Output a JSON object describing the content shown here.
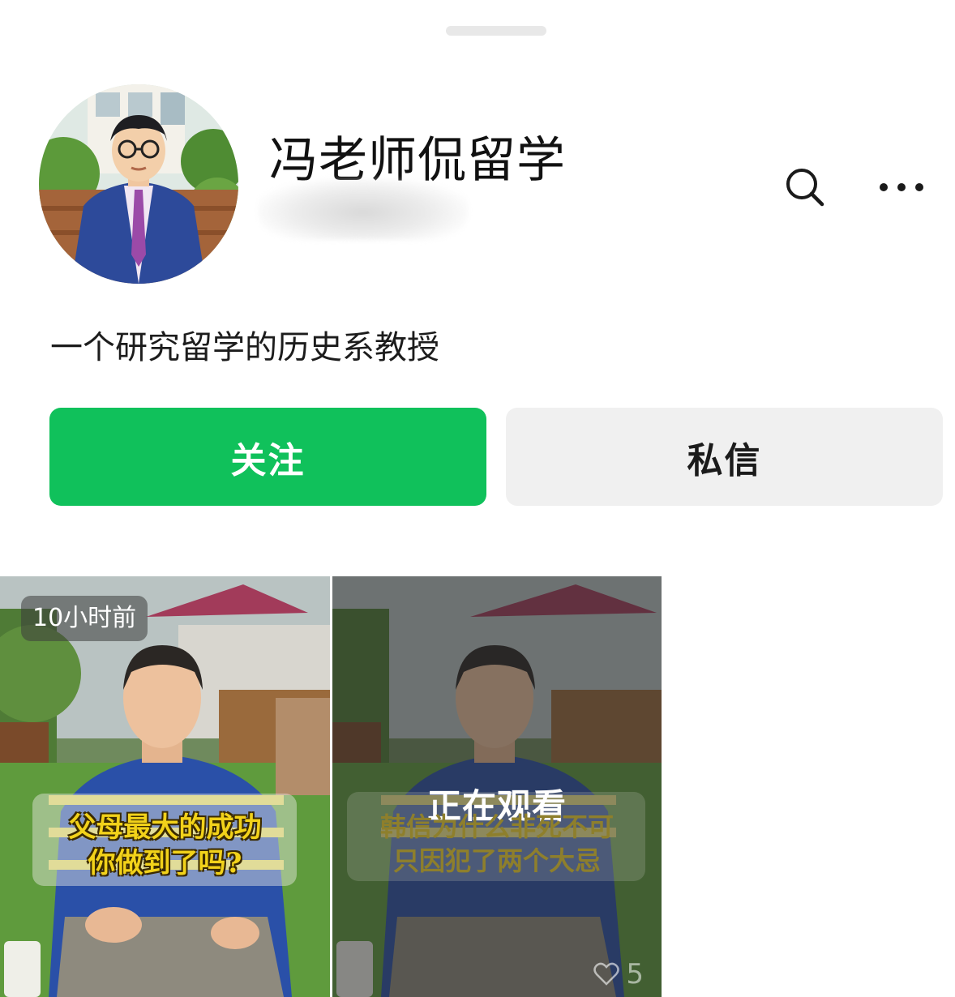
{
  "profile": {
    "name": "冯老师侃留学",
    "bio": "一个研究留学的历史系教授"
  },
  "header_icons": {
    "search": "search-icon",
    "more": "more-icon"
  },
  "actions": {
    "follow_label": "关注",
    "message_label": "私信"
  },
  "colors": {
    "accent": "#10c15b",
    "secondary_button": "#f0f0f0"
  },
  "videos": [
    {
      "time_label": "10小时前",
      "caption_line1": "父母最大的成功",
      "caption_line2": "你做到了吗?",
      "likes": ""
    },
    {
      "status_label": "正在观看",
      "caption_line1": "韩信为什么非死不可",
      "caption_line2": "只因犯了两个大忌",
      "likes": "5"
    }
  ]
}
